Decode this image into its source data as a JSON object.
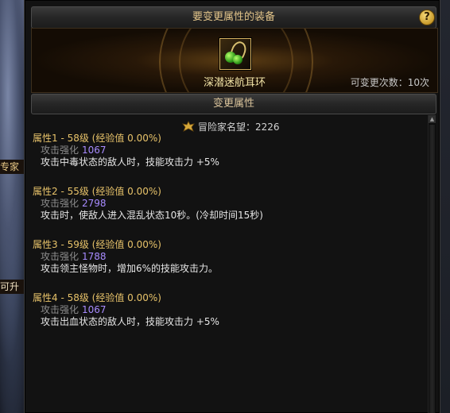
{
  "background": {
    "label_one": "专家",
    "label_two": "可升"
  },
  "dialog": {
    "title": "要变更属性的装备",
    "help_icon": "?",
    "item": {
      "name": "深潜迷航耳环",
      "icon": "earring-icon",
      "change_count": "可变更次数：10次"
    },
    "section_title": "变更属性",
    "fame": {
      "label": "冒险家名望：2226",
      "icon": "fame-crest-icon"
    },
    "attributes": [
      {
        "title": "属性1 - 58级 (经验值 0.00%)",
        "stat_label": "攻击强化",
        "stat_value": "1067",
        "description": "攻击中毒状态的敌人时，技能攻击力 +5%"
      },
      {
        "title": "属性2 - 55级 (经验值 0.00%)",
        "stat_label": "攻击强化",
        "stat_value": "2798",
        "description": "攻击时，使敌人进入混乱状态10秒。(冷却时间15秒)"
      },
      {
        "title": "属性3 - 59级 (经验值 0.00%)",
        "stat_label": "攻击强化",
        "stat_value": "1788",
        "description": "攻击领主怪物时，增加6%的技能攻击力。"
      },
      {
        "title": "属性4 - 58级 (经验值 0.00%)",
        "stat_label": "攻击强化",
        "stat_value": "1067",
        "description": "攻击出血状态的敌人时，技能攻击力 +5%"
      }
    ]
  },
  "colors": {
    "attr_title": "#e8c36a",
    "stat_value": "#a78bff",
    "header_text": "#e2c48a"
  }
}
